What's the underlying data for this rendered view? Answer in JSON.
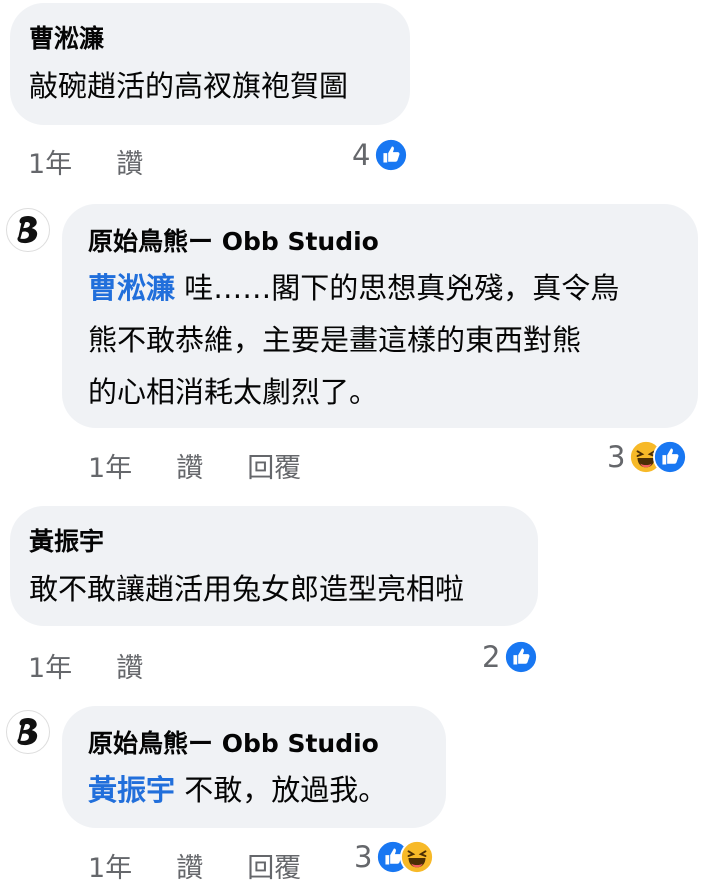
{
  "comments": [
    {
      "author": "曹淞濂",
      "text": "敲碗趙活的高衩旗袍賀圖",
      "time": "1年",
      "like": "讚",
      "reaction_count": "4",
      "reactions": [
        "like-icon"
      ]
    },
    {
      "author": "原始鳥熊ー Obb Studio",
      "mention": "曹淞濂",
      "line1": " 哇……閣下的思想真兇殘，真令鳥",
      "line2": "熊不敢恭維，主要是畫這樣的東西對熊",
      "line3": "的心相消耗太劇烈了。",
      "time": "1年",
      "like": "讚",
      "reply": "回覆",
      "reaction_count": "3",
      "reactions": [
        "haha-icon",
        "like-icon"
      ]
    },
    {
      "author": "黃振宇",
      "text": "敢不敢讓趙活用兔女郎造型亮相啦",
      "time": "1年",
      "like": "讚",
      "reaction_count": "2",
      "reactions": [
        "like-icon"
      ]
    },
    {
      "author": "原始鳥熊ー Obb Studio",
      "mention": "黃振宇",
      "text": " 不敢，放過我。",
      "time": "1年",
      "like": "讚",
      "reply": "回覆",
      "reaction_count": "3",
      "reactions": [
        "like-icon",
        "haha-icon"
      ]
    }
  ],
  "colors": {
    "bubble": "#f0f2f5",
    "mention": "#216fdb",
    "meta": "#65676b",
    "like": "#1877f2",
    "haha": "#f7b928"
  }
}
